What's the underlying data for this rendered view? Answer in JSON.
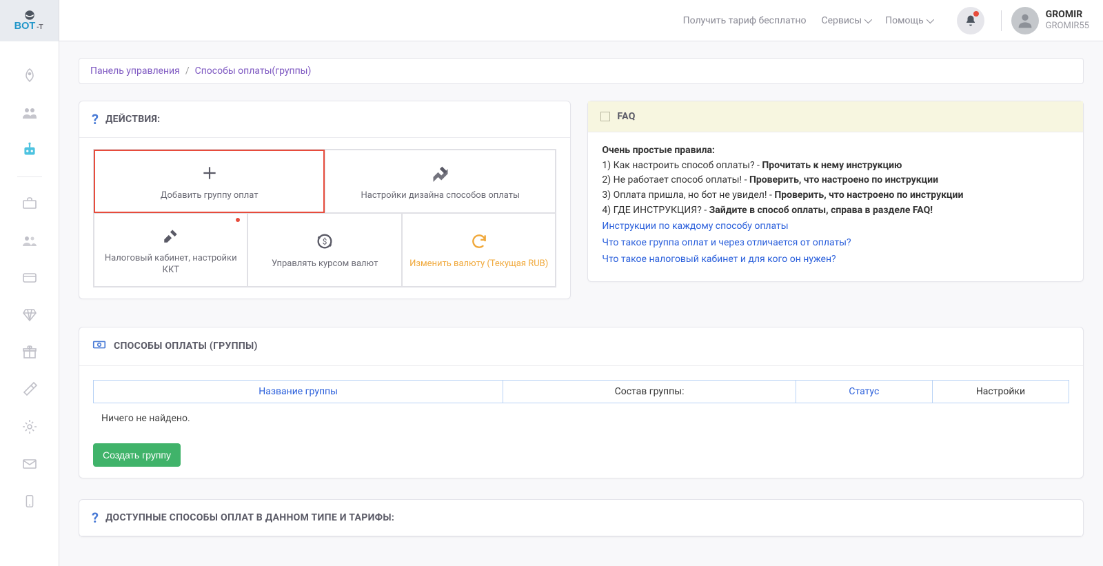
{
  "header": {
    "free_tariff": "Получить тариф бесплатно",
    "services": "Сервисы",
    "help": "Помощь",
    "user_name": "GROMIR",
    "user_sub": "GROMIR55"
  },
  "breadcrumb": {
    "dashboard": "Панель управления",
    "current": "Способы оплаты(группы)"
  },
  "actions": {
    "title": "ДЕЙСТВИЯ:",
    "tiles": {
      "add_group": "Добавить группу оплат",
      "design_settings": "Настройки дизайна способов оплаты",
      "tax_kkt": "Налоговый кабинет, настройки ККТ",
      "currency_rate": "Управлять курсом валют",
      "change_currency": "Изменить валюту (Текущая RUB)"
    }
  },
  "faq": {
    "title": "FAQ",
    "rules_heading": "Очень простые правила:",
    "r1_prefix": "1) Как настроить способ оплаты? - ",
    "r1_bold": "Прочитать к нему инструкцию",
    "r2_prefix": "2) Не работает способ оплаты! - ",
    "r2_bold": "Проверить, что настроено по инструкции",
    "r3_prefix": "3) Оплата пришла, но бот не увидел! - ",
    "r3_bold": "Проверить, что настроено по инструкции",
    "r4_prefix": "4) ГДЕ ИНСТРУКЦИЯ? - ",
    "r4_bold": "Зайдите в способ оплаты, справа в разделе FAQ!",
    "link1": "Инструкции по каждому способу оплаты",
    "link2": "Что такое группа оплат и через отличается от оплаты?",
    "link3": "Что такое налоговый кабинет и для кого он нужен?"
  },
  "payment_groups": {
    "title": "СПОСОБЫ ОПЛАТЫ (ГРУППЫ)",
    "col_name": "Название группы",
    "col_composition": "Состав группы:",
    "col_status": "Статус",
    "col_settings": "Настройки",
    "empty": "Ничего не найдено.",
    "create_btn": "Создать группу"
  },
  "available": {
    "title": "ДОСТУПНЫЕ СПОСОБЫ ОПЛАТ В ДАННОМ ТИПЕ И ТАРИФЫ:"
  }
}
